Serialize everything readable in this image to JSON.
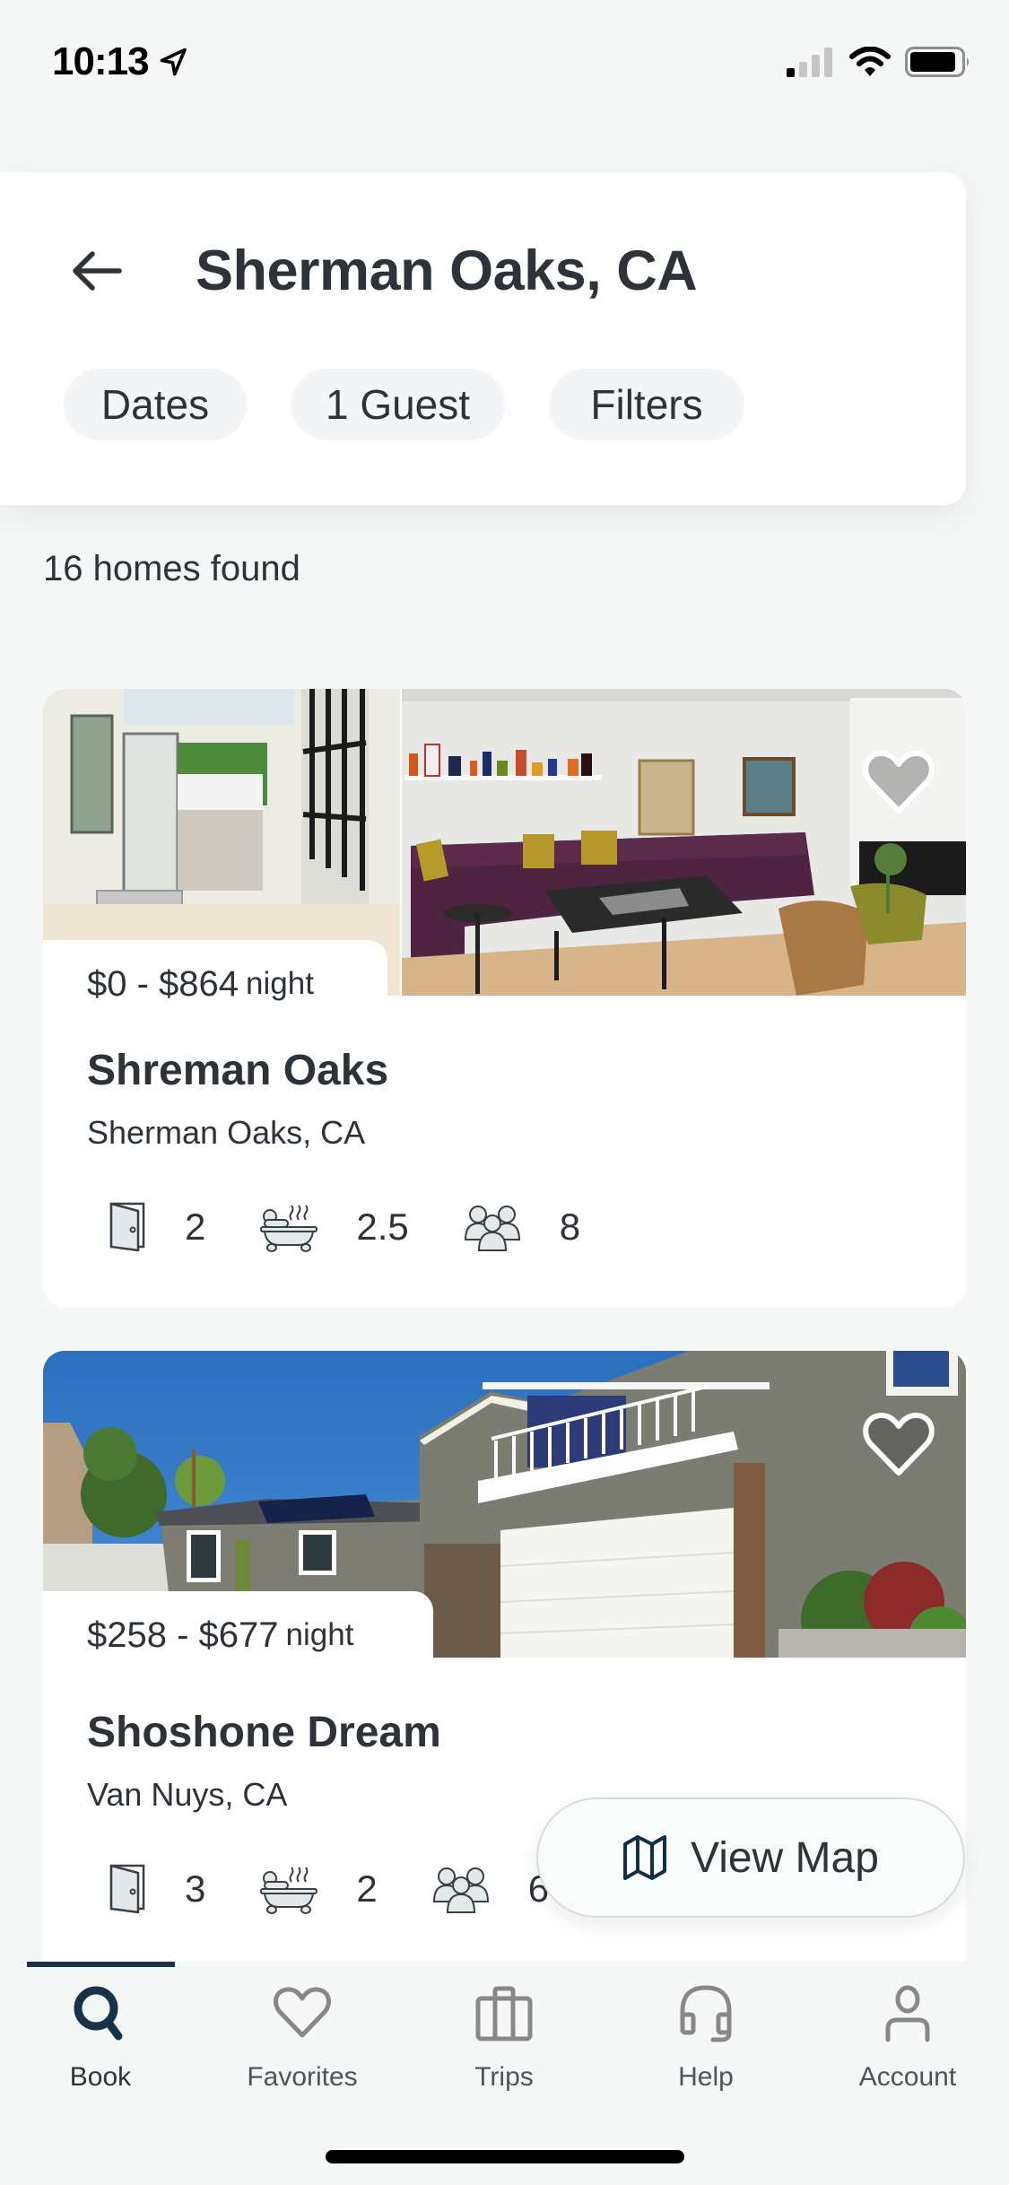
{
  "status_bar": {
    "time": "10:13",
    "signal_bars_active": 1,
    "signal_bars_total": 4,
    "battery_level": 0.85,
    "icons": [
      "location-arrow-icon",
      "signal-icon",
      "wifi-icon",
      "battery-icon"
    ]
  },
  "header": {
    "back_icon": "arrow-left-icon",
    "title": "Sherman Oaks, CA",
    "filters": [
      {
        "label": "Dates"
      },
      {
        "label": "1 Guest"
      },
      {
        "label": "Filters"
      }
    ]
  },
  "results": {
    "count_text": "16 homes found"
  },
  "listings": [
    {
      "price": "$0 - $864",
      "price_unit": "night",
      "name": "Shreman Oaks",
      "location": "Sherman Oaks, CA",
      "bedrooms": "2",
      "bathrooms": "2.5",
      "guests": "8",
      "favorite_icon": "heart-outline-icon",
      "photo": "interior-living-room"
    },
    {
      "price": "$258 - $677",
      "price_unit": "night",
      "name": "Shoshone Dream",
      "location": "Van Nuys, CA",
      "bedrooms": "3",
      "bathrooms": "2",
      "guests": "6",
      "favorite_icon": "heart-outline-icon",
      "photo": "house-exterior"
    }
  ],
  "view_map": {
    "label": "View Map",
    "icon": "map-icon"
  },
  "tabbar": {
    "active": "Book",
    "items": [
      {
        "label": "Book",
        "icon": "search-icon"
      },
      {
        "label": "Favorites",
        "icon": "heart-icon"
      },
      {
        "label": "Trips",
        "icon": "suitcase-icon"
      },
      {
        "label": "Help",
        "icon": "headset-icon"
      },
      {
        "label": "Account",
        "icon": "person-icon"
      }
    ]
  },
  "colors": {
    "accent": "#17324a",
    "text": "#2d3338",
    "background": "#f6f8f8",
    "pill_bg": "#f3f5f6",
    "inactive_icon": "#888888"
  }
}
